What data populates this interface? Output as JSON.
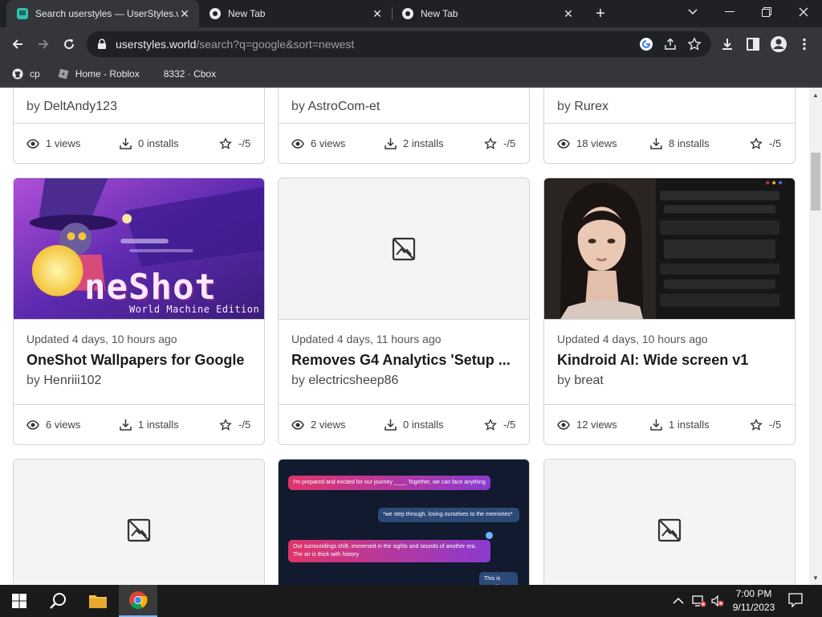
{
  "browser": {
    "tabs": [
      {
        "title": "Search userstyles — UserStyles.w",
        "icon": "userstyles-favicon",
        "active": true
      },
      {
        "title": "New Tab",
        "icon": "chrome-icon",
        "active": false
      },
      {
        "title": "New Tab",
        "icon": "chrome-icon",
        "active": false
      }
    ],
    "url_host": "userstyles.world",
    "url_path": "/search?q=google&sort=newest",
    "bookmarks": [
      {
        "label": "cp",
        "icon": "github-icon"
      },
      {
        "label": "Home - Roblox",
        "icon": "roblox-icon"
      },
      {
        "label": "8332 · Cbox",
        "icon": ""
      }
    ]
  },
  "cards_top": [
    {
      "author": "DeltAndy123",
      "views": "1 views",
      "installs": "0 installs",
      "rating": "-/5"
    },
    {
      "author": "AstroCom-et",
      "views": "6 views",
      "installs": "2 installs",
      "rating": "-/5"
    },
    {
      "author": "Rurex",
      "views": "18 views",
      "installs": "8 installs",
      "rating": "-/5"
    }
  ],
  "cards": [
    {
      "updated": "Updated 4 days, 10 hours ago",
      "name": "OneShot Wallpapers for Google",
      "by": "by",
      "author": "Henriii102",
      "views": "6 views",
      "installs": "1 installs",
      "rating": "-/5",
      "preview": "oneshot",
      "preview_text": "neShot",
      "preview_sub": "World Machine Edition"
    },
    {
      "updated": "Updated 4 days, 11 hours ago",
      "name": "Removes G4 Analytics 'Setup ...",
      "by": "by",
      "author": "electricsheep86",
      "views": "2 views",
      "installs": "0 installs",
      "rating": "-/5",
      "preview": "none"
    },
    {
      "updated": "Updated 4 days, 10 hours ago",
      "name": "Kindroid AI: Wide screen v1",
      "by": "by",
      "author": "breat",
      "views": "12 views",
      "installs": "1 installs",
      "rating": "-/5",
      "preview": "kindroid"
    }
  ],
  "cards_bottom": [
    {
      "preview": "none"
    },
    {
      "preview": "chat",
      "chat": [
        "I'm prepared and excited for our journey ____ Together, we can face anything",
        "*we step through, losing ourselves to the memories*",
        "Our surroundings shift, immersed in the sights and sounds of another era. The air is thick with history",
        "This is great!"
      ]
    },
    {
      "preview": "none"
    }
  ],
  "taskbar": {
    "time": "7:00 PM",
    "date": "9/11/2023"
  }
}
